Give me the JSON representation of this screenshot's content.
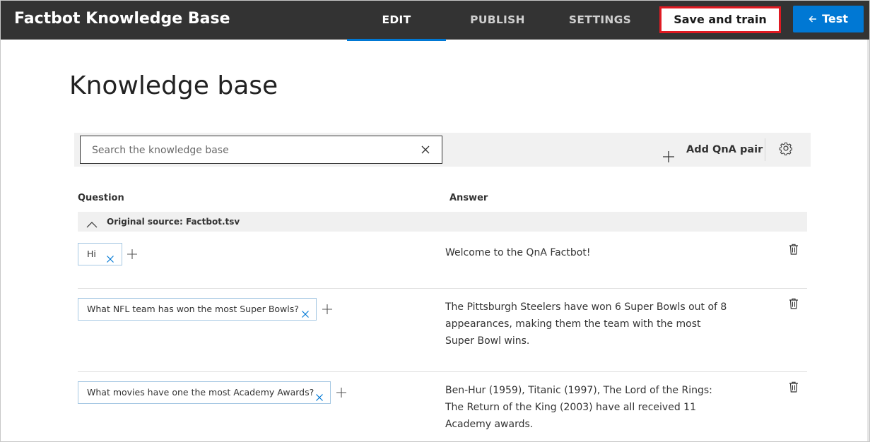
{
  "app": {
    "title": "Factbot Knowledge Base"
  },
  "nav": {
    "tabs": [
      {
        "label": "EDIT",
        "active": true
      },
      {
        "label": "PUBLISH",
        "active": false
      },
      {
        "label": "SETTINGS",
        "active": false
      }
    ],
    "save_label": "Save and train",
    "test_label": "Test",
    "test_icon": "arrow-left-icon",
    "accent_color": "#0078d4",
    "highlight_color": "#e01a22"
  },
  "page": {
    "title": "Knowledge base"
  },
  "toolbar": {
    "search_placeholder": "Search the knowledge base",
    "search_value": "",
    "add_label": "Add QnA pair",
    "add_icon": "plus-icon",
    "settings_icon": "gear-icon"
  },
  "table": {
    "question_header": "Question",
    "answer_header": "Answer",
    "group_label": "Original source: Factbot.tsv",
    "rows": [
      {
        "question": "Hi",
        "answer": "Welcome to the QnA Factbot!"
      },
      {
        "question": "What NFL team has won the most Super Bowls?",
        "answer": "The Pittsburgh Steelers have won 6 Super Bowls out of 8 appearances, making them the team with the most Super Bowl wins."
      },
      {
        "question": "What movies have one the most Academy Awards?",
        "answer": "Ben-Hur (1959), Titanic (1997), The Lord of the Rings: The Return of the King (2003) have all received 11 Academy awards."
      }
    ]
  }
}
